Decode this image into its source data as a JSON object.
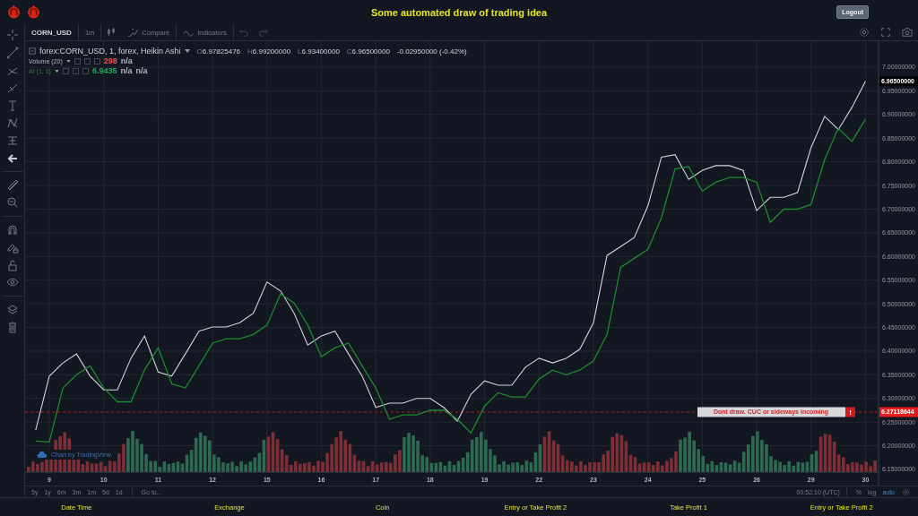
{
  "header": {
    "title": "Some automated draw of trading idea",
    "logout": "Logout"
  },
  "toolbar": {
    "symbol": "CORN_USD",
    "interval": "1m",
    "compare": "Compare",
    "indicators": "Indicators"
  },
  "legend": {
    "ohlc": [
      {
        "label": "O",
        "value": "6.97825476"
      },
      {
        "label": "H",
        "value": "6.99200000"
      },
      {
        "label": "L",
        "value": "6.93400000"
      },
      {
        "label": "C",
        "value": "6.96500000"
      }
    ],
    "change": "-0.02950000 (-0.42%)",
    "studies": [
      {
        "name": "Volume (20)",
        "values": [
          {
            "text": "298",
            "color": "#ef5350"
          },
          {
            "text": "n/a",
            "color": "#b2b5be"
          }
        ]
      },
      {
        "values": [
          {
            "text": "6.9435",
            "color": "#26a65b"
          },
          {
            "text": "n/a",
            "color": "#b2b5be"
          },
          {
            "text": "n/a",
            "color": "#b2b5be"
          }
        ]
      }
    ]
  },
  "chart_data": {
    "type": "line",
    "categories": [
      null,
      "9",
      null,
      null,
      null,
      "10",
      null,
      null,
      null,
      "11",
      null,
      null,
      null,
      "12",
      null,
      null,
      null,
      "15",
      null,
      null,
      null,
      "16",
      null,
      null,
      null,
      "17",
      null,
      null,
      null,
      "18",
      null,
      null,
      null,
      "19",
      null,
      null,
      null,
      "22",
      null,
      null,
      null,
      "23",
      null,
      null,
      null,
      "24",
      null,
      null,
      null,
      "25",
      null,
      null,
      null,
      "26",
      null,
      null,
      null,
      "29",
      null,
      null,
      null,
      "30"
    ],
    "series": [
      {
        "name": "forex:CORN_USD, 1, forex, Heikin Ashi",
        "color": "#d1d4dc",
        "values": [
          6.233,
          6.347,
          6.375,
          6.394,
          6.347,
          6.318,
          6.318,
          6.385,
          6.432,
          6.356,
          6.347,
          6.394,
          6.442,
          6.451,
          6.451,
          6.46,
          6.48,
          6.546,
          6.527,
          6.48,
          6.413,
          6.432,
          6.442,
          6.394,
          6.347,
          6.281,
          6.29,
          6.29,
          6.3,
          6.3,
          6.281,
          6.252,
          6.309,
          6.337,
          6.328,
          6.328,
          6.366,
          6.385,
          6.375,
          6.385,
          6.404,
          6.46,
          6.602,
          6.621,
          6.64,
          6.707,
          6.81,
          6.815,
          6.763,
          6.782,
          6.792,
          6.792,
          6.782,
          6.697,
          6.725,
          6.725,
          6.735,
          6.83,
          6.896,
          6.868,
          6.915,
          6.97
        ]
      },
      {
        "name": "AI (1, 1)",
        "color": "#1e8a2e",
        "values": [
          6.21,
          6.208,
          6.322,
          6.35,
          6.369,
          6.322,
          6.293,
          6.293,
          6.36,
          6.407,
          6.331,
          6.322,
          6.369,
          6.417,
          6.426,
          6.426,
          6.435,
          6.455,
          6.521,
          6.502,
          6.455,
          6.388,
          6.407,
          6.417,
          6.369,
          6.322,
          6.256,
          6.265,
          6.265,
          6.275,
          6.275,
          6.256,
          6.227,
          6.284,
          6.312,
          6.303,
          6.303,
          6.341,
          6.36,
          6.35,
          6.36,
          6.379,
          6.435,
          6.577,
          6.596,
          6.615,
          6.682,
          6.785,
          6.79,
          6.738,
          6.757,
          6.767,
          6.767,
          6.757,
          6.672,
          6.7,
          6.7,
          6.71,
          6.805,
          6.871,
          6.843,
          6.89
        ]
      }
    ],
    "ylim": [
      6.1443,
      7.0549
    ],
    "yticks": [
      {
        "value": 7.0,
        "label": "7.00000000"
      },
      {
        "value": 6.95,
        "label": "6.95000000"
      },
      {
        "value": 6.9,
        "label": "6.90000000"
      },
      {
        "value": 6.85,
        "label": "6.85000000"
      },
      {
        "value": 6.8,
        "label": "6.80000000"
      },
      {
        "value": 6.75,
        "label": "6.75000000"
      },
      {
        "value": 6.7,
        "label": "6.70000000"
      },
      {
        "value": 6.65,
        "label": "6.65000000"
      },
      {
        "value": 6.6,
        "label": "6.60000000"
      },
      {
        "value": 6.55,
        "label": "6.55000000"
      },
      {
        "value": 6.5,
        "label": "6.50000000"
      },
      {
        "value": 6.45,
        "label": "6.45000000"
      },
      {
        "value": 6.4,
        "label": "6.40000000"
      },
      {
        "value": 6.35,
        "label": "6.35000000"
      },
      {
        "value": 6.3,
        "label": "6.30000000"
      },
      {
        "value": 6.25,
        "label": "6.25000000"
      },
      {
        "value": 6.2,
        "label": "6.20000000"
      },
      {
        "value": 6.15,
        "label": "6.15000000"
      }
    ],
    "grid": true,
    "ref_lines": [
      {
        "axis": "y",
        "value": 6.27118644,
        "label": "Dont draw. CUC or sideways incoming"
      }
    ]
  },
  "last_price_tag": "6.96500000",
  "alert": {
    "flag": "!",
    "tag": "6.27118644"
  },
  "watermark": "Chart by TradingView",
  "bottom_bar": {
    "ranges": [
      {
        "label": "5y",
        "selected": false
      },
      {
        "label": "1y",
        "selected": false
      },
      {
        "label": "6m",
        "selected": false
      },
      {
        "label": "3m",
        "selected": false
      },
      {
        "label": "1m",
        "selected": false
      },
      {
        "label": "5d",
        "selected": false
      },
      {
        "label": "1d",
        "selected": false
      }
    ],
    "goto": "Go to...",
    "time": "00:52:10 (UTC)",
    "scales": [
      {
        "label": "%",
        "selected": false
      },
      {
        "label": "log",
        "selected": false
      },
      {
        "label": "auto",
        "selected": true
      }
    ]
  },
  "footer": [
    "Date Time",
    "Exchange",
    "Coin",
    "Entry or Take Profit 2",
    "Take Profit 1",
    "Entry or Take Profit 2"
  ]
}
